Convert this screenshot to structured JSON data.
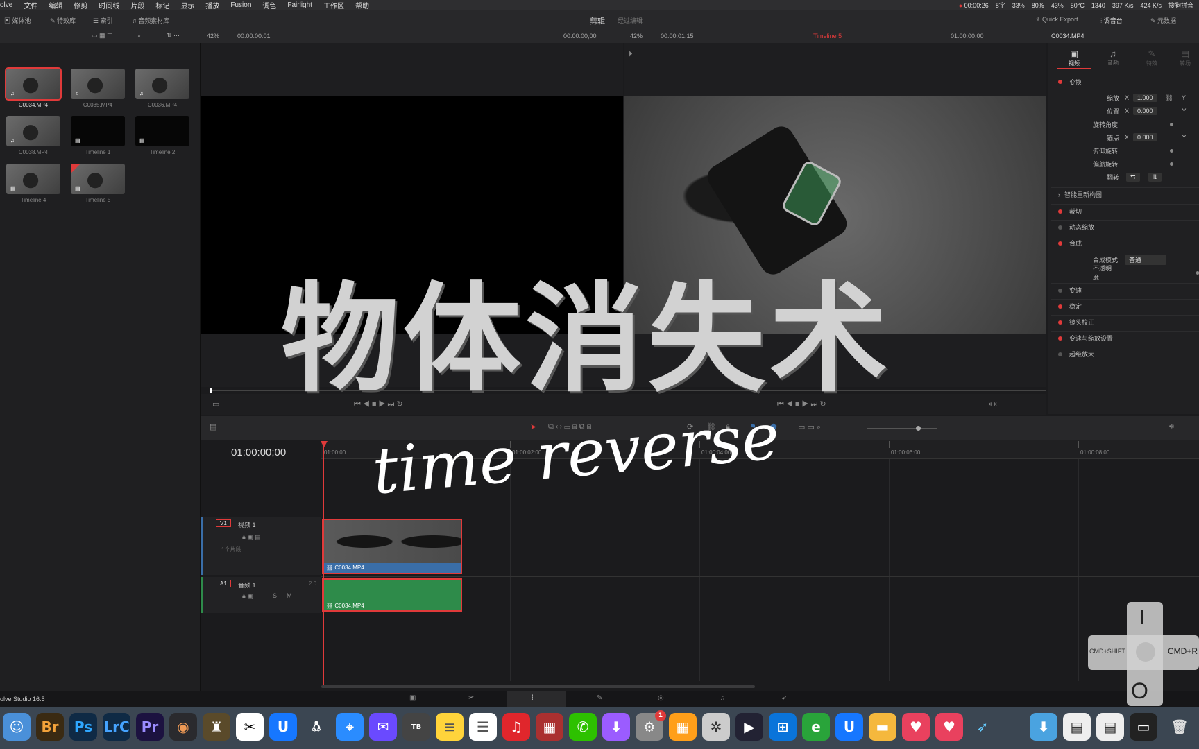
{
  "menubar": {
    "items": [
      "olve",
      "文件",
      "编辑",
      "修剪",
      "时间线",
      "片段",
      "标记",
      "显示",
      "播放",
      "Fusion",
      "调色",
      "Fairlight",
      "工作区",
      "帮助"
    ],
    "record_time": "00:00:26",
    "status": [
      "8字",
      "33%",
      "80%",
      "43%",
      "50°C",
      "1340",
      "397 K/s",
      "424 K/s"
    ],
    "ime": "搜狗拼音"
  },
  "toolbar": {
    "media_pool": "媒体池",
    "effects": "特效库",
    "index": "索引",
    "sound_library": "音频素材库",
    "center_title": "剪辑",
    "center_sub": "经过编辑",
    "quick_export": "Quick Export",
    "mixer": "调音台",
    "metadata": "元数据"
  },
  "viewer_bar": {
    "left_zoom": "42%",
    "left_tc": "00:00:00:01",
    "left_tc2": "00:00:00;00",
    "right_zoom": "42%",
    "right_tc": "00:00:01:15",
    "timeline_name": "Timeline 5",
    "right_tc2": "01:00:00;00",
    "clip_name": "C0034.MP4"
  },
  "media_pool": {
    "clips": [
      {
        "label": "C0034.MP4",
        "type": "video",
        "selected": true
      },
      {
        "label": "C0035.MP4",
        "type": "video"
      },
      {
        "label": "C0036.MP4",
        "type": "video"
      },
      {
        "label": "C0038.MP4",
        "type": "video"
      },
      {
        "label": "Timeline 1",
        "type": "timeline"
      },
      {
        "label": "Timeline 2",
        "type": "timeline"
      },
      {
        "label": "Timeline 4",
        "type": "timeline"
      },
      {
        "label": "Timeline 5",
        "type": "timeline"
      }
    ]
  },
  "overlay": {
    "title": "物体消失术",
    "subtitle": "time reverse"
  },
  "inspector": {
    "tabs": [
      "视频",
      "音频",
      "特效",
      "转场"
    ],
    "sections": {
      "transform": "变换",
      "zoom_label": "缩放",
      "zoom_x": "1.000",
      "position_label": "位置",
      "position_x": "0.000",
      "rotation_label": "旋转角度",
      "anchor_label": "锚点",
      "anchor_x": "0.000",
      "pitch_label": "俯仰旋转",
      "yaw_label": "偏航旋转",
      "flip_label": "翻转",
      "smart_reframe": "智能重新构图",
      "crop": "裁切",
      "dynamic_zoom": "动态缩放",
      "composite": "合成",
      "composite_mode_label": "合成模式",
      "composite_mode_value": "普通",
      "opacity_label": "不透明度",
      "speed_change": "变速",
      "stabilize": "稳定",
      "lens_correction": "镜头校正",
      "retime_scaling": "变速与缩放设置",
      "super_scale": "超级放大"
    },
    "x": "X",
    "y": "Y"
  },
  "timeline": {
    "timecode": "01:00:00;00",
    "ruler": [
      "01:00:00",
      "01:00:02:00",
      "01:00:04:00",
      "01:00:06:00",
      "01:00:08:00"
    ],
    "tracks": [
      {
        "id": "V1",
        "name": "视频 1",
        "sub": "1个片段",
        "clip": "C0034.MP4"
      },
      {
        "id": "A1",
        "name": "音频 1",
        "level": "2.0",
        "clip": "C0034.MP4",
        "solo": "S",
        "mute": "M"
      }
    ]
  },
  "statusbar": {
    "app": "olve Studio 16.5"
  },
  "keyboard_overlay": {
    "top": "I",
    "bottom": "O",
    "left": "CMD+SHIFT",
    "right": "CMD+R"
  },
  "dock": {
    "apps": [
      "Br",
      "Ps",
      "LrC",
      "Pr"
    ],
    "badge": "1"
  },
  "colors": {
    "accent_red": "#e03a3a",
    "video_clip": "#3a6ea8",
    "audio_clip": "#2e8b4a"
  }
}
